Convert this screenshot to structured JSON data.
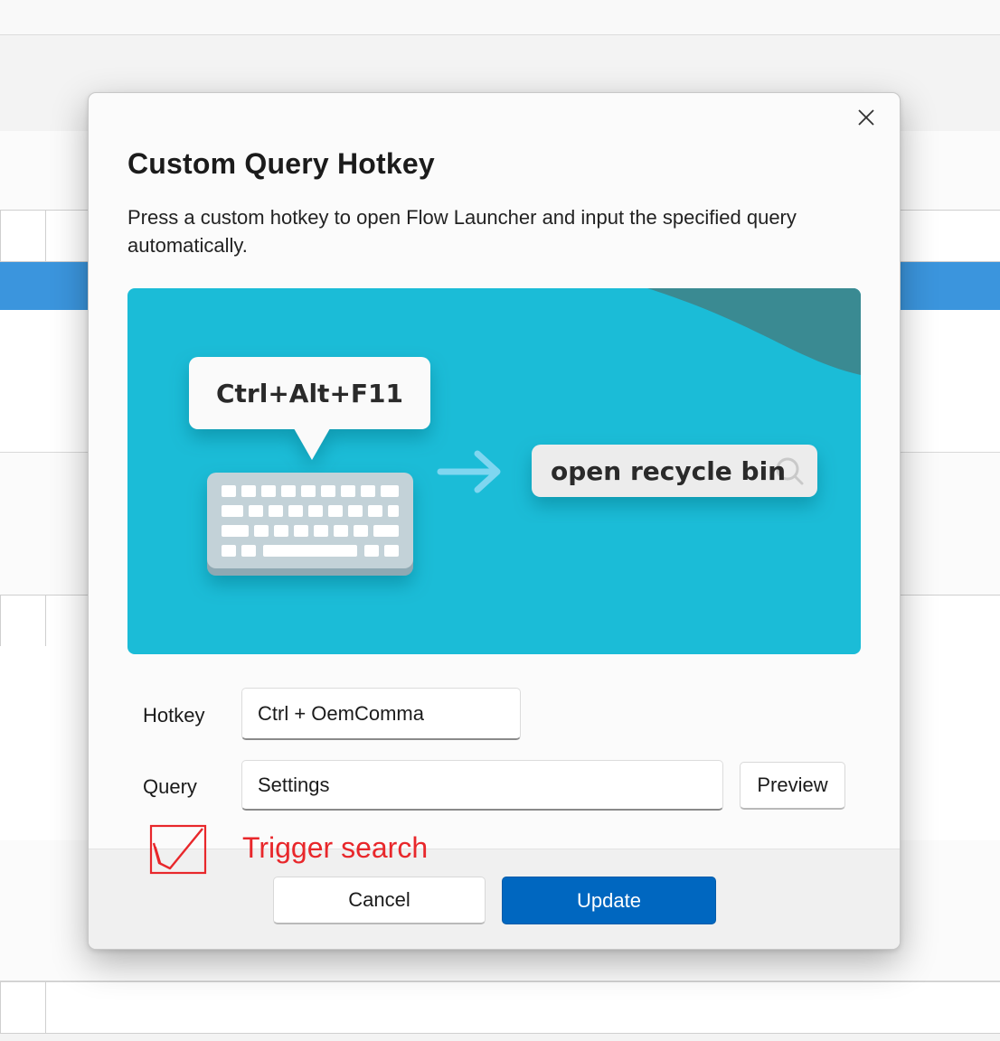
{
  "dialog": {
    "title": "Custom Query Hotkey",
    "description": "Press a custom hotkey to open Flow Launcher and input the specified query automatically.",
    "close_icon": "close-icon"
  },
  "illustration": {
    "hotkey_bubble": "Ctrl+Alt+F11",
    "search_text": "open recycle bin",
    "icons": [
      "keyboard-icon",
      "arrow-right-icon",
      "search-icon"
    ],
    "colors": {
      "background": "#1bbcd7",
      "corner_accent": "#3a8a92",
      "arrow": "#7fd6f0"
    }
  },
  "form": {
    "hotkey_label": "Hotkey",
    "hotkey_value": "Ctrl + OemComma",
    "query_label": "Query",
    "query_value": "Settings",
    "preview_label": "Preview"
  },
  "footer": {
    "cancel_label": "Cancel",
    "update_label": "Update"
  },
  "annotation": {
    "text": "Trigger search",
    "color": "#e8272b"
  },
  "colors": {
    "accent": "#0067c0",
    "selected_row": "#3b95dd"
  }
}
